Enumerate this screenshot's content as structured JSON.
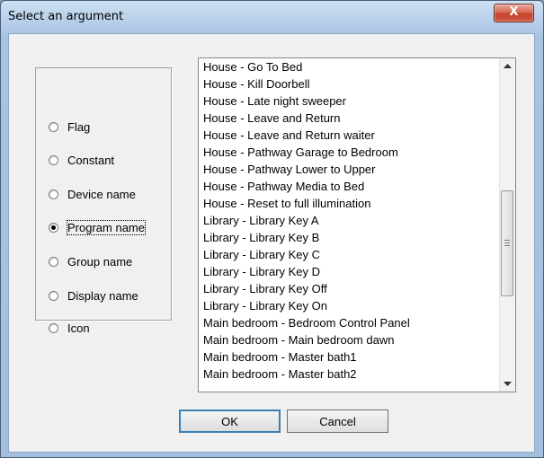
{
  "window": {
    "title": "Select an argument",
    "close_glyph": "X"
  },
  "argument_types": {
    "selected_index": 3,
    "options": [
      {
        "label": "Flag",
        "selected": false
      },
      {
        "label": "Constant",
        "selected": false
      },
      {
        "label": "Device name",
        "selected": false
      },
      {
        "label": "Program name",
        "selected": true
      },
      {
        "label": "Group name",
        "selected": false
      },
      {
        "label": "Display name",
        "selected": false
      },
      {
        "label": "Icon",
        "selected": false
      }
    ]
  },
  "program_list": {
    "items": [
      "House - Go To Bed",
      "House - Kill Doorbell",
      "House - Late night sweeper",
      "House - Leave and Return",
      "House - Leave and Return waiter",
      "House - Pathway Garage to Bedroom",
      "House - Pathway Lower to Upper",
      "House - Pathway Media to Bed",
      "House - Reset to full illumination",
      "Library - Library Key A",
      "Library - Library Key B",
      "Library - Library Key C",
      "Library - Library Key D",
      "Library - Library Key Off",
      "Library - Library Key On",
      "Main bedroom - Bedroom Control Panel",
      "Main bedroom - Main bedroom dawn",
      "Main bedroom - Master bath1",
      "Main bedroom - Master bath2"
    ]
  },
  "buttons": {
    "ok_label": "OK",
    "cancel_label": "Cancel"
  },
  "colors": {
    "title_gradient_top": "#cfe0f2",
    "close_button": "#c5422b",
    "default_button_border": "#3c7fb1",
    "dialog_face": "#f0f0f0"
  }
}
